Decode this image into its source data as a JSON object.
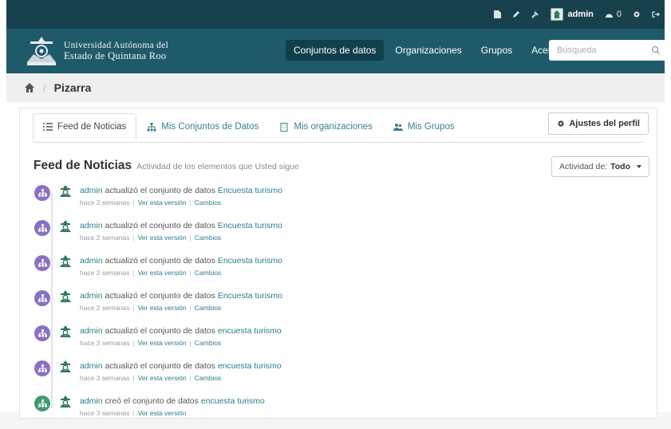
{
  "account": {
    "username": "admin",
    "dashboard_count": "0"
  },
  "masthead": {
    "logo_line1": "Universidad Autónoma del",
    "logo_line2": "Estado de Quintana Roo",
    "nav": [
      "Conjuntos de datos",
      "Organizaciones",
      "Grupos",
      "Acerca de"
    ],
    "active_nav": "Conjuntos de datos",
    "search_placeholder": "Búsqueda"
  },
  "breadcrumb": {
    "current": "Pizarra"
  },
  "tabs": [
    {
      "label": "Feed de Noticias",
      "icon": "list-icon"
    },
    {
      "label": "Mis Conjuntos de Datos",
      "icon": "sitemap-icon"
    },
    {
      "label": "Mis organizaciones",
      "icon": "building-icon"
    },
    {
      "label": "Mis Grupos",
      "icon": "users-icon"
    }
  ],
  "profile_button": "Ajustes del perfil",
  "feed": {
    "title": "Feed de Noticias",
    "subtitle": "Actividad de los elementos que Usted sigue",
    "activity_filter_label": "Actividad de:",
    "activity_filter_value": "Todo"
  },
  "activities": [
    {
      "actor": "admin",
      "action": "actualizó el conjunto de datos",
      "dataset": "Encuesta turismo",
      "time": "hace 2 semanas",
      "links": [
        "Ver esta versión",
        "Cambios"
      ],
      "kind": "update"
    },
    {
      "actor": "admin",
      "action": "actualizó el conjunto de datos",
      "dataset": "Encuesta turismo",
      "time": "hace 2 semanas",
      "links": [
        "Ver esta versión",
        "Cambios"
      ],
      "kind": "update"
    },
    {
      "actor": "admin",
      "action": "actualizó el conjunto de datos",
      "dataset": "Encuesta turismo",
      "time": "hace 2 semanas",
      "links": [
        "Ver esta versión",
        "Cambios"
      ],
      "kind": "update"
    },
    {
      "actor": "admin",
      "action": "actualizó el conjunto de datos",
      "dataset": "Encuesta turismo",
      "time": "hace 2 semanas",
      "links": [
        "Ver esta versión",
        "Cambios"
      ],
      "kind": "update"
    },
    {
      "actor": "admin",
      "action": "actualizó el conjunto de datos",
      "dataset": "encuesta turismo",
      "time": "hace 3 semanas",
      "links": [
        "Ver esta versión",
        "Cambios"
      ],
      "kind": "update"
    },
    {
      "actor": "admin",
      "action": "actualizó el conjunto de datos",
      "dataset": "encuesta turismo",
      "time": "hace 3 semanas",
      "links": [
        "Ver esta versión",
        "Cambios"
      ],
      "kind": "update"
    },
    {
      "actor": "admin",
      "action": "creó el conjunto de datos",
      "dataset": "encuesta turismo",
      "time": "hace 3 semanas",
      "links": [
        "Ver esta versión"
      ],
      "kind": "create"
    }
  ],
  "colors": {
    "account_bar": "#17414d",
    "masthead": "#1f5a6b",
    "link": "#2d7c91",
    "update_circle": "#8a71c2",
    "create_circle": "#3f9b70"
  }
}
